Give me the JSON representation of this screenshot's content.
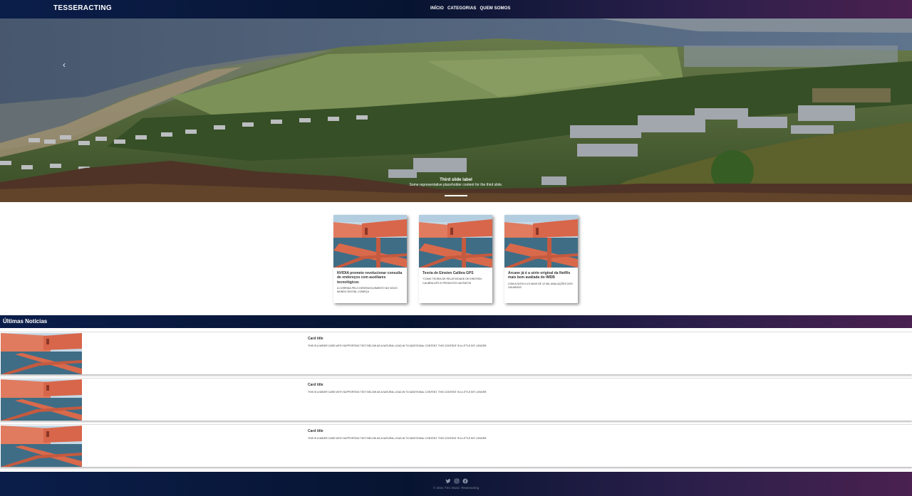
{
  "navbar": {
    "brand": "TESSERACTING",
    "links": [
      "INÍCIO",
      "CATEGORIAS",
      "QUEM SOMOS"
    ]
  },
  "hero": {
    "prev_icon": "chevron-left-icon",
    "prev_glyph": "‹",
    "caption_title": "Third slide label",
    "caption_text": "Some representative placeholder content for the third slide."
  },
  "featured": [
    {
      "title": "NVIDIA promete revolucionar consulta de endereços com auxiliares tecnológicos",
      "text": "A corrida pelo desenvolvimento no novo mundo digital começa"
    },
    {
      "title": "Teoria de Einsten Calibra GPS",
      "text": "\"Como teoria de relatividade de Einstein calibra GPS e produtos um ratos"
    },
    {
      "title": "Arcane já é a série original da Netflix mais bem avaliada do IMDB",
      "text": "Com a nota 9.4 e mais de 12 mil avaliações dos usuários"
    }
  ],
  "section": {
    "title": "Últimas Notícias"
  },
  "news": [
    {
      "title": "Card title",
      "text": "This is a wider card with supporting text below as a natural lead-in to additional content. This content is a little bit longer."
    },
    {
      "title": "Card title",
      "text": "This is a wider card with supporting text below as a natural lead-in to additional content. This content is a little bit longer."
    },
    {
      "title": "Card title",
      "text": "This is a wider card with supporting text below as a natural lead-in to additional content. This content is a little bit longer."
    }
  ],
  "footer": {
    "social_icons": [
      "twitter-icon",
      "instagram-icon",
      "facebook-icon"
    ],
    "copyright": "© 2021 TSC Music Tesseracting"
  },
  "colors": {
    "bar_start": "#0b1e4a",
    "bar_end": "#4a2150",
    "footer_text": "#7b8192"
  }
}
